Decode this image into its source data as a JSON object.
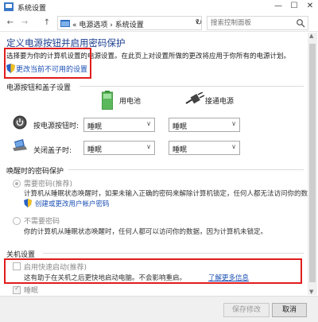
{
  "window": {
    "title": "系统设置",
    "minimize": "—",
    "maximize": "☐",
    "close": "✕"
  },
  "address": {
    "back": "←",
    "forward": "→",
    "up": "↑",
    "crumbs": "« 电源选项 › 系统设置",
    "dropdown_arrow": "∨",
    "refresh": "↻",
    "search_placeholder": "搜索控制面板"
  },
  "page": {
    "title": "定义电源按钮并启用密码保护",
    "intro": "选择要为你的计算机设置的电源设置。在此页上对设置所做的更改将应用于你所有的电源计划。",
    "change_link": "更改当前不可用的设置"
  },
  "power_buttons": {
    "section_title": "电源按钮和盖子设置",
    "col_battery": "用电池",
    "col_plugged": "接通电源",
    "rows": [
      {
        "label": "按电源按钮时:",
        "battery": "睡眠",
        "plugged": "睡眠"
      },
      {
        "label": "关闭盖子时:",
        "battery": "睡眠",
        "plugged": "睡眠"
      }
    ]
  },
  "password": {
    "section_title": "唤醒时的密码保护",
    "require_label": "需要密码(推荐)",
    "require_desc_1": "计算机从睡眠状态唤醒时，如果未输入正确的密码来解除计算机锁定，任何人都无法访问你的数据。",
    "require_desc_2": "创建或更改用户帐户密码",
    "norequire_label": "不需要密码",
    "norequire_desc": "你的计算机从睡眠状态唤醒时，任何人都可以访问你的数据，因为计算机未锁定。"
  },
  "shutdown": {
    "section_title": "关机设置",
    "fast_startup_label": "启用快速启动(推荐)",
    "fast_startup_desc": "这有助于在关机之后更快地启动电脑。不会影响重启。",
    "learn_more": "了解更多信息",
    "sleep_label": "睡眠"
  },
  "footer": {
    "save": "保存修改",
    "cancel": "取消"
  },
  "colors": {
    "title_blue": "#1b3d8f",
    "link_blue": "#1a4fb5",
    "highlight_red": "#e11c1c"
  }
}
